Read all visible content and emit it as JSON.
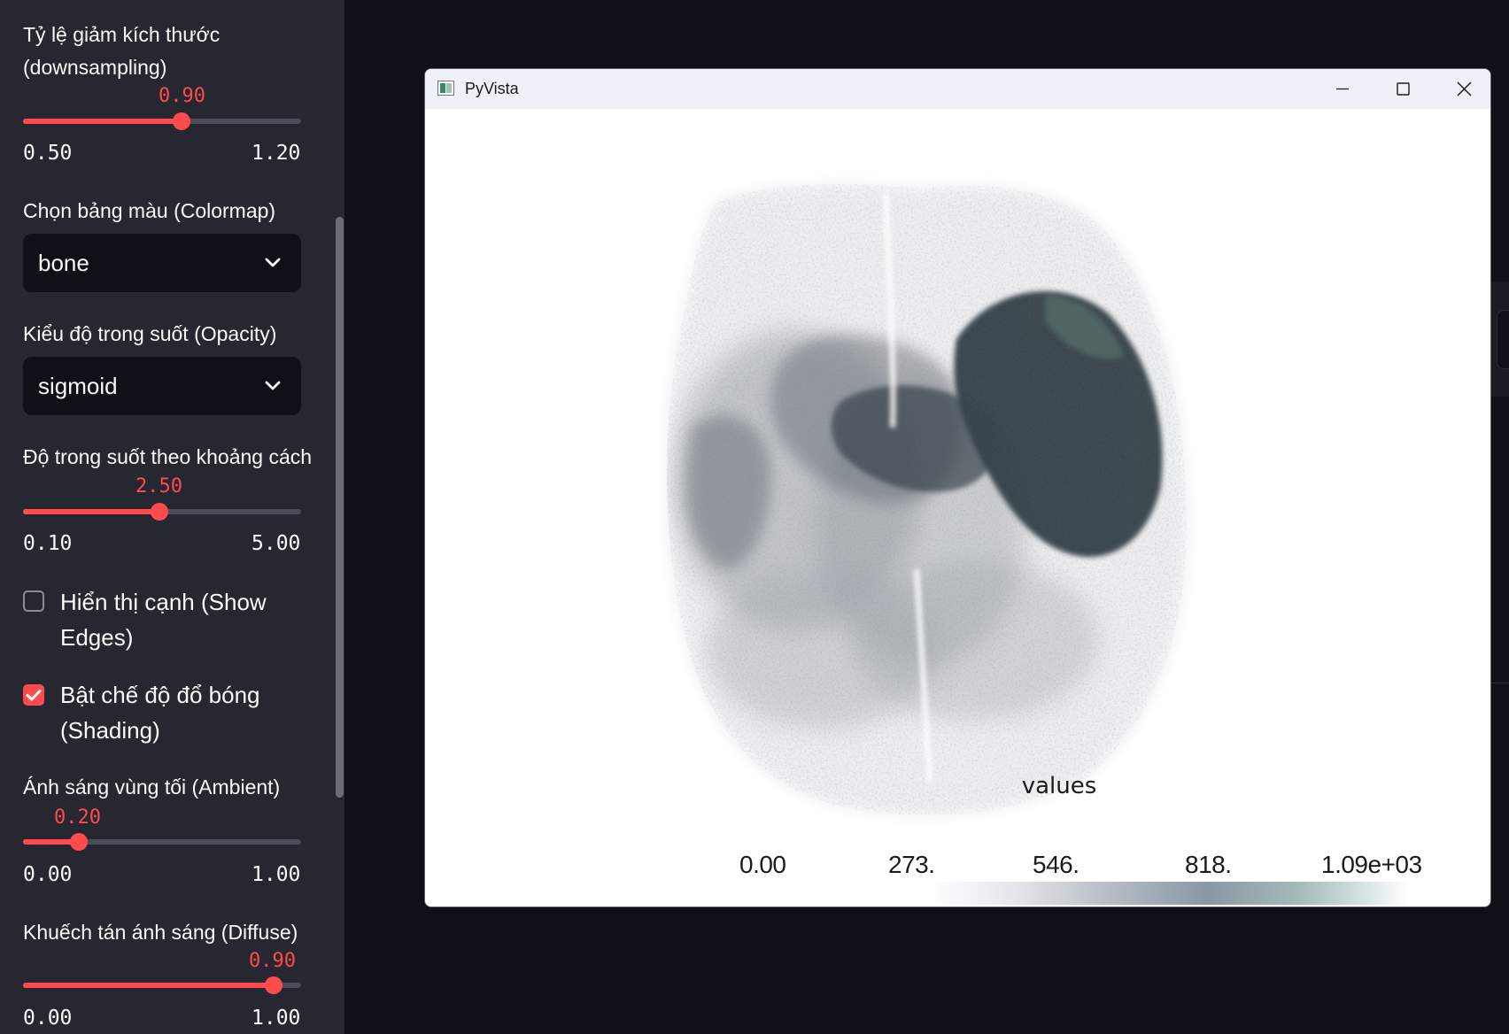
{
  "sidebar": {
    "downsampling": {
      "label": "Tỷ lệ giảm kích thước (downsampling)",
      "value": "0.90",
      "min": "0.50",
      "max": "1.20",
      "fraction": 0.571
    },
    "colormap": {
      "label": "Chọn bảng màu (Colormap)",
      "selected": "bone"
    },
    "opacity": {
      "label": "Kiểu độ trong suốt (Opacity)",
      "selected": "sigmoid"
    },
    "opacity_distance": {
      "label": "Độ trong suốt theo khoảng cách",
      "value": "2.50",
      "min": "0.10",
      "max": "5.00",
      "fraction": 0.49
    },
    "show_edges": {
      "label": "Hiển thị cạnh (Show Edges)",
      "checked": false
    },
    "shading": {
      "label": "Bật chế độ đổ bóng (Shading)",
      "checked": true
    },
    "ambient": {
      "label": "Ánh sáng vùng tối (Ambient)",
      "value": "0.20",
      "min": "0.00",
      "max": "1.00",
      "fraction": 0.2
    },
    "diffuse": {
      "label": "Khuếch tán ánh sáng (Diffuse)",
      "value": "0.90",
      "min": "0.00",
      "max": "1.00",
      "fraction": 0.9
    }
  },
  "window": {
    "title": "PyVista",
    "icons": {
      "app": "pyvista-app-icon",
      "minimize": "minimize-icon",
      "maximize": "maximize-icon",
      "close": "close-icon"
    },
    "colorbar": {
      "title": "values",
      "ticks": [
        "0.00",
        "273.",
        "546.",
        "818.",
        "1.09e+03"
      ]
    }
  },
  "colors": {
    "accent": "#ff4b4b",
    "sidebar_bg": "#262730",
    "app_bg": "#0e1117",
    "select_bg": "#0e1117"
  }
}
